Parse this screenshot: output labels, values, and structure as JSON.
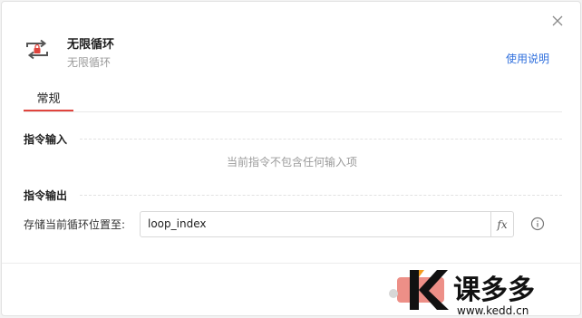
{
  "header": {
    "title": "无限循环",
    "subtitle": "无限循环",
    "help_link": "使用说明"
  },
  "tabs": [
    {
      "label": "常规",
      "active": true
    }
  ],
  "sections": {
    "input": {
      "title": "指令输入",
      "empty_text": "当前指令不包含任何输入项"
    },
    "output": {
      "title": "指令输出",
      "field_label": "存储当前循环位置至:",
      "field_value": "loop_index",
      "fx_label": "fx"
    }
  },
  "watermark": {
    "brand": "课多多",
    "url": "www.kedd.cn"
  },
  "colors": {
    "accent": "#e0443d",
    "link": "#2f6fdd",
    "muted": "#9b9b9b"
  }
}
